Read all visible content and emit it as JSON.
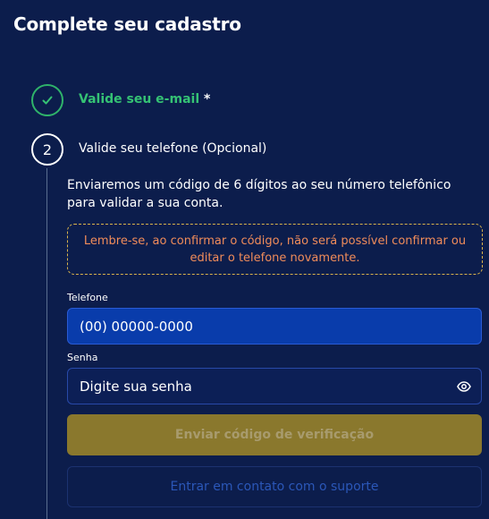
{
  "page": {
    "title": "Complete seu cadastro"
  },
  "steps": [
    {
      "label": "Valide seu e-mail",
      "required_mark": "*",
      "status": "completed",
      "icon": "check-icon",
      "color": "#35c274"
    },
    {
      "number": "2",
      "label": "Valide seu telefone (Opcional)",
      "status": "active"
    }
  ],
  "phone_step": {
    "description": "Enviaremos um código de 6 dígitos ao seu número telefônico para validar a sua conta.",
    "warning": "Lembre-se, ao confirmar o código, não será possível confirmar ou editar o telefone novamente.",
    "phone_label": "Telefone",
    "phone_placeholder": "(00) 00000-0000",
    "password_label": "Senha",
    "password_placeholder": "Digite sua senha",
    "password_toggle_icon": "eye-icon",
    "send_button": "Enviar código de verificação",
    "support_button": "Entrar em contato com o suporte"
  },
  "colors": {
    "background": "#0c1d4c",
    "success": "#35c274",
    "warning_border": "#d9b34b",
    "warning_text": "#f08c5a",
    "primary_button_disabled": "#8a782d",
    "phone_input_bg": "#093cab"
  }
}
